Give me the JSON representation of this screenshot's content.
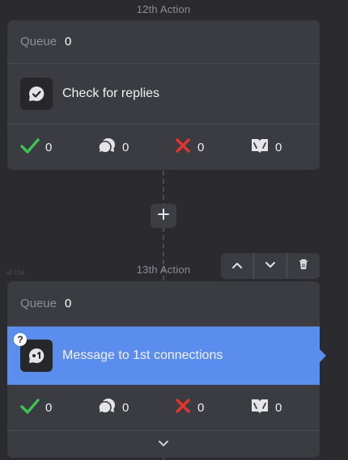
{
  "workflow": {
    "actions": [
      {
        "title": "12th Action",
        "queue_label": "Queue",
        "queue_value": "0",
        "task_label": "Check for replies",
        "task_icon": "chat-check-icon",
        "stats": {
          "success": "0",
          "replied": "0",
          "failed": "0",
          "skipped": "0"
        }
      },
      {
        "title": "13th Action",
        "queue_label": "Queue",
        "queue_value": "0",
        "task_label": "Message to 1st connections",
        "task_icon": "message-1st-icon",
        "help": "?",
        "node_id": "id-194",
        "stats": {
          "success": "0",
          "replied": "0",
          "failed": "0",
          "skipped": "0"
        }
      }
    ]
  },
  "colors": {
    "background": "#2a2a2f",
    "card": "#3b3b42",
    "active": "#5b8def",
    "success": "#3cc451",
    "failed": "#e2352d"
  }
}
